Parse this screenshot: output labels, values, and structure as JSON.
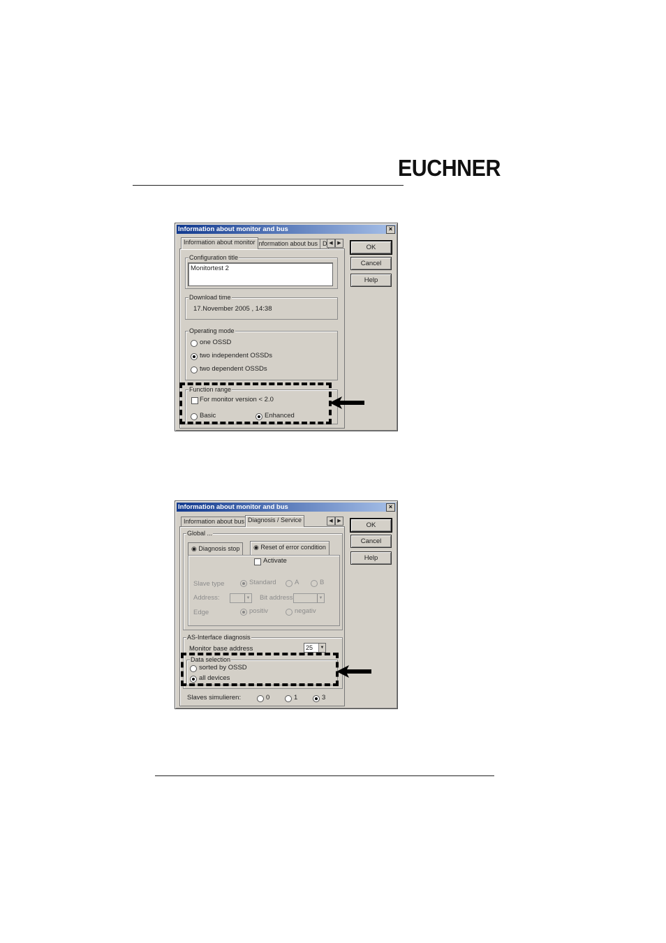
{
  "brand": {
    "logo_text": "EUCHNER"
  },
  "dialog1": {
    "title": "Information about monitor and bus",
    "tabs": [
      "Information about monitor",
      "Information about bus",
      "D"
    ],
    "buttons": {
      "ok": "OK",
      "cancel": "Cancel",
      "help": "Help"
    },
    "config_title": {
      "label": "Configuration title",
      "value": "Monitortest 2"
    },
    "download_time": {
      "label": "Download time",
      "value": "17.November 2005  ,  14:38"
    },
    "operating_mode": {
      "label": "Operating mode",
      "options": [
        "one OSSD",
        "two independent OSSDs",
        "two dependent OSSDs"
      ],
      "selected_index": 1
    },
    "function_range": {
      "label": "Function range",
      "checkbox_label": "For monitor version < 2.0",
      "checkbox_checked": false,
      "options": [
        "Basic",
        "Enhanced"
      ],
      "selected_index": 1
    }
  },
  "dialog2": {
    "title": "Information about monitor and bus",
    "tabs": [
      "Information about bus",
      "Diagnosis / Service"
    ],
    "buttons": {
      "ok": "OK",
      "cancel": "Cancel",
      "help": "Help"
    },
    "global": {
      "label": "Global ...",
      "subtabs": [
        "Diagnosis stop",
        "Reset of error condition"
      ],
      "activate_label": "Activate",
      "slave_type_label": "Slave type",
      "slave_type_options": [
        "Standard",
        "A",
        "B"
      ],
      "address_label": "Address:",
      "bit_address_label": "Bit address:",
      "edge_label": "Edge",
      "edge_options": [
        "positiv",
        "negativ"
      ]
    },
    "as_interface": {
      "label": "AS-Interface diagnosis",
      "monitor_base_label": "Monitor base address",
      "monitor_base_value": "25",
      "data_selection_label": "Data selection",
      "data_selection_options": [
        "sorted by OSSD",
        "all devices"
      ],
      "data_selection_selected": 1
    },
    "slaves_simulated": {
      "label": "Slaves simulieren:",
      "options": [
        "0",
        "1",
        "3"
      ],
      "selected_index": 2
    }
  }
}
